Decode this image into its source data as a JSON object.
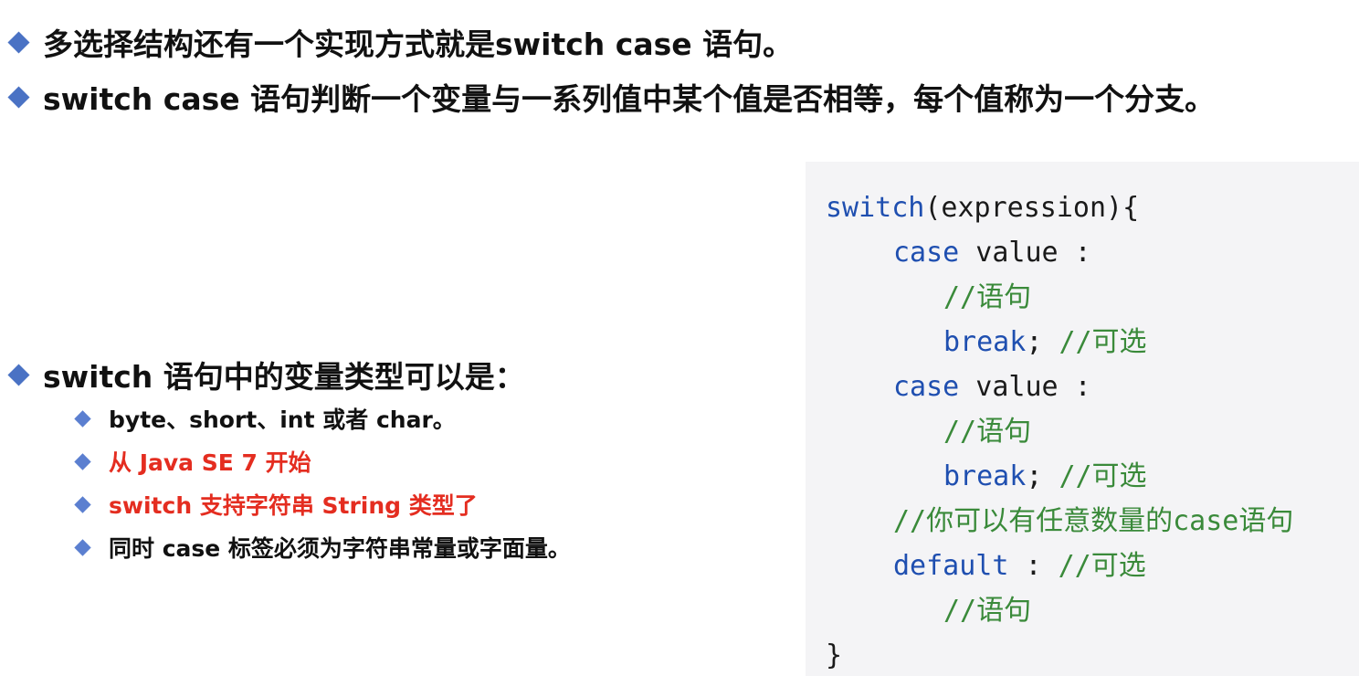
{
  "bullets": {
    "b1": "多选择结构还有一个实现方式就是switch case 语句。",
    "b2": "switch case 语句判断一个变量与一系列值中某个值是否相等，每个值称为一个分支。",
    "b3": "switch 语句中的变量类型可以是：",
    "sub": [
      "byte、short、int 或者 char。",
      "从 Java SE 7 开始",
      "switch 支持字符串 String 类型了",
      "同时 case 标签必须为字符串常量或字面量。"
    ]
  },
  "code": {
    "l1_kw": "switch",
    "l1_rest": "(expression){",
    "l2_kw": "case",
    "l2_rest": " value :",
    "l3_cm": "//语句",
    "l4_kw": "break",
    "l4_rest": "; ",
    "l4_cm": "//可选",
    "l5_kw": "case",
    "l5_rest": " value :",
    "l6_cm": "//语句",
    "l7_kw": "break",
    "l7_rest": "; ",
    "l7_cm": "//可选",
    "l8_cm1": "//你可以有任意数量的",
    "l8_cm2": "case",
    "l8_cm3": "语句",
    "l9_kw": "default",
    "l9_rest": " : ",
    "l9_cm": "//可选",
    "l10_cm": "//语句",
    "l11": "}"
  },
  "colors": {
    "bullet": "#4a72c4",
    "highlight": "#e42d20",
    "keyword": "#1f4fb0",
    "comment": "#3a8a3a",
    "code_bg": "#f4f4f6"
  }
}
